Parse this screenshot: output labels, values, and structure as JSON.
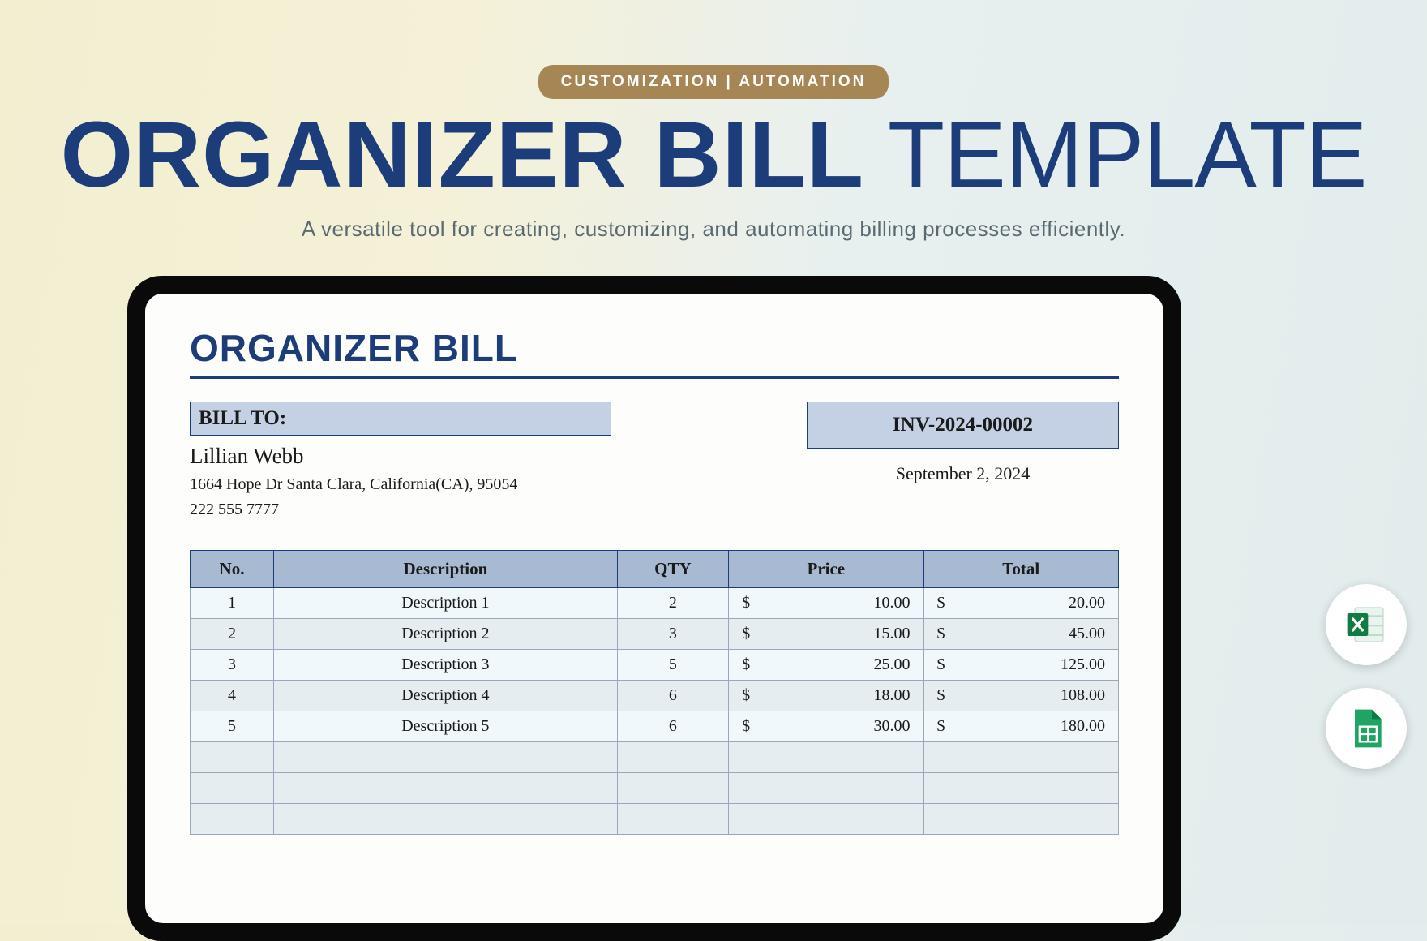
{
  "header": {
    "badge": "CUSTOMIZATION  |  AUTOMATION",
    "title_bold": "ORGANIZER BILL",
    "title_light": " TEMPLATE",
    "subtitle": "A versatile tool for creating, customizing, and automating billing processes efficiently."
  },
  "document": {
    "title": "ORGANIZER BILL",
    "bill_to_label": "BILL TO:",
    "customer_name": "Lillian Webb",
    "customer_address": "1664 Hope Dr Santa Clara, California(CA), 95054",
    "customer_phone": "222 555 7777",
    "invoice_number": "INV-2024-00002",
    "invoice_date": "September 2, 2024",
    "columns": {
      "no": "No.",
      "description": "Description",
      "qty": "QTY",
      "price": "Price",
      "total": "Total"
    },
    "currency": "$",
    "rows": [
      {
        "no": "1",
        "description": "Description 1",
        "qty": "2",
        "price": "10.00",
        "total": "20.00"
      },
      {
        "no": "2",
        "description": "Description 2",
        "qty": "3",
        "price": "15.00",
        "total": "45.00"
      },
      {
        "no": "3",
        "description": "Description 3",
        "qty": "5",
        "price": "25.00",
        "total": "125.00"
      },
      {
        "no": "4",
        "description": "Description 4",
        "qty": "6",
        "price": "18.00",
        "total": "108.00"
      },
      {
        "no": "5",
        "description": "Description 5",
        "qty": "6",
        "price": "30.00",
        "total": "180.00"
      }
    ]
  },
  "icons": {
    "excel": "excel-icon",
    "sheets": "sheets-icon"
  }
}
